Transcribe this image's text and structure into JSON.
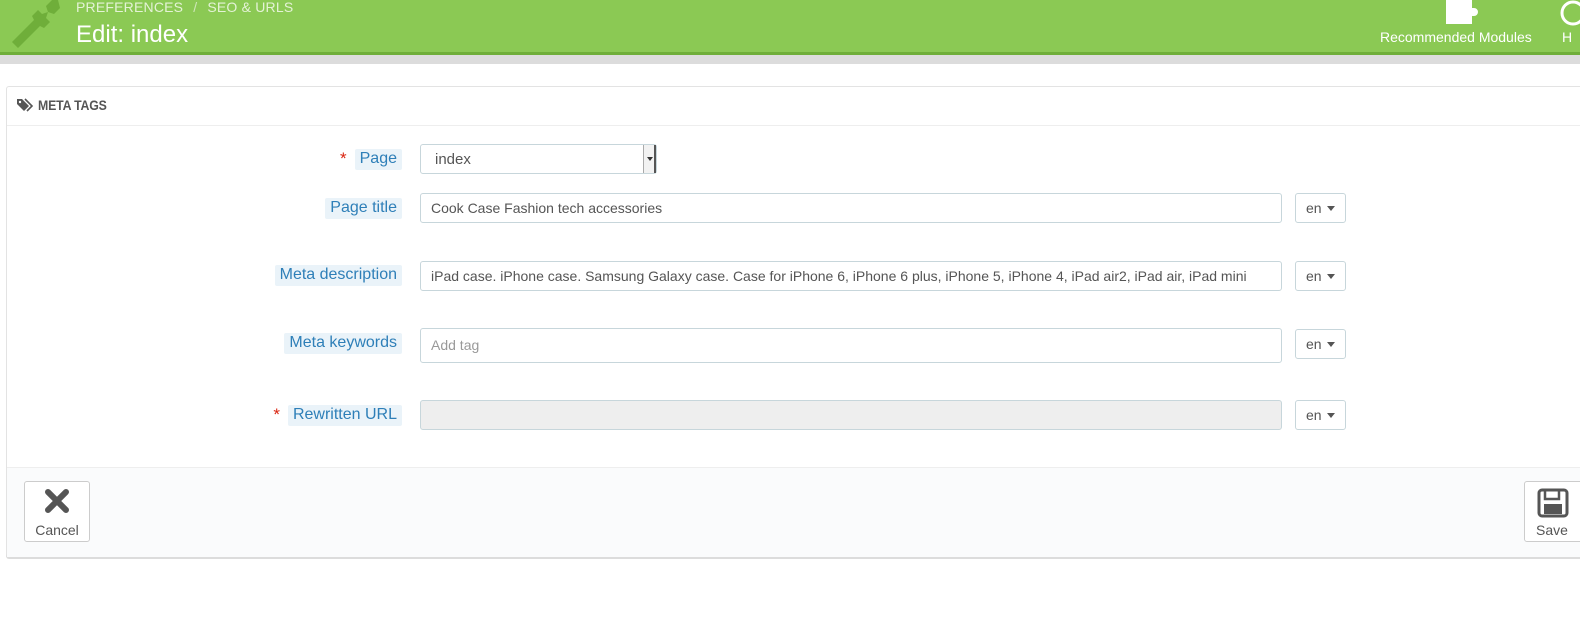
{
  "header": {
    "breadcrumb": [
      "PREFERENCES",
      "SEO & URLS"
    ],
    "breadcrumb_separator": "/",
    "title": "Edit: index",
    "toolbar": {
      "recommended_modules": "Recommended Modules",
      "help": "H"
    },
    "colors": {
      "bar": "#8bc954",
      "accent_border": "#6fae3a"
    }
  },
  "panel": {
    "heading": "META TAGS",
    "heading_icon": "tag-icon",
    "fields": {
      "page": {
        "label": "Page",
        "required": "*",
        "value": "index"
      },
      "page_title": {
        "label": "Page title",
        "value": "Cook Case Fashion tech accessories",
        "lang": "en"
      },
      "meta_description": {
        "label": "Meta description",
        "value": "iPad case. iPhone case. Samsung Galaxy case. Case for iPhone 6, iPhone 6 plus, iPhone 5, iPhone 4, iPad air2, iPad air, iPad mini",
        "lang": "en"
      },
      "meta_keywords": {
        "label": "Meta keywords",
        "placeholder": "Add tag",
        "lang": "en"
      },
      "rewritten_url": {
        "label": "Rewritten URL",
        "required": "*",
        "value": "",
        "lang": "en"
      }
    },
    "footer": {
      "cancel": "Cancel",
      "save": "Save"
    }
  }
}
